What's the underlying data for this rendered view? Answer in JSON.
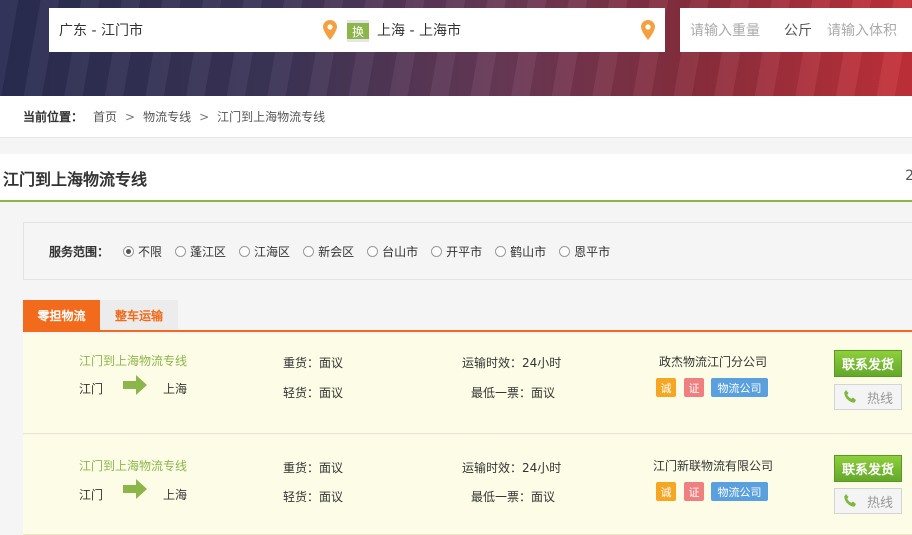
{
  "search": {
    "from_value": "广东 - 江门市",
    "swap_label": "换",
    "to_value": "上海 - 上海市",
    "weight_placeholder": "请输入重量",
    "weight_unit": "公斤",
    "volume_placeholder": "请输入体积"
  },
  "breadcrumb": {
    "label": "当前位置：",
    "items": [
      "首页",
      "物流专线",
      "江门到上海物流专线"
    ],
    "sep": ">"
  },
  "section": {
    "title": "江门到上海物流专线",
    "edge_text": "2"
  },
  "filter": {
    "label": "服务范围：",
    "options": [
      "不限",
      "蓬江区",
      "江海区",
      "新会区",
      "台山市",
      "开平市",
      "鹤山市",
      "恩平市"
    ],
    "selected": "不限"
  },
  "tabs": [
    "零担物流",
    "整车运输"
  ],
  "rows": [
    {
      "route": "江门到上海物流专线",
      "from": "江门",
      "to": "上海",
      "heavy": "重货：面议",
      "light": "轻货：面议",
      "time": "运输时效：24小时",
      "min": "最低一票：面议",
      "company": "政杰物流江门分公司",
      "badges": [
        "诚",
        "证",
        "物流公司"
      ],
      "contact": "联系发货",
      "hotline": "热线"
    },
    {
      "route": "江门到上海物流专线",
      "from": "江门",
      "to": "上海",
      "heavy": "重货：面议",
      "light": "轻货：面议",
      "time": "运输时效：24小时",
      "min": "最低一票：面议",
      "company": "江门新联物流有限公司",
      "badges": [
        "诚",
        "证",
        "物流公司"
      ],
      "contact": "联系发货",
      "hotline": "热线"
    }
  ],
  "colors": {
    "accent_green": "#8cb64a",
    "accent_orange": "#f26a1b"
  }
}
